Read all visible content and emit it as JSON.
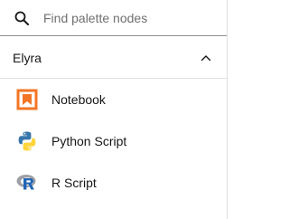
{
  "search": {
    "placeholder": "Find palette nodes",
    "value": "",
    "icon": "search-icon"
  },
  "category": {
    "title": "Elyra",
    "expanded": true,
    "icon": "chevron-up-icon"
  },
  "nodes": [
    {
      "label": "Notebook",
      "icon": "notebook-icon",
      "color": "#f37626"
    },
    {
      "label": "Python Script",
      "icon": "python-icon",
      "color": "#3776ab"
    },
    {
      "label": "R Script",
      "icon": "r-script-icon",
      "color": "#1f65b7"
    }
  ],
  "colors": {
    "notebook_orange": "#f37626",
    "python_blue": "#3776ab",
    "python_yellow": "#ffd43b",
    "r_blue": "#1f65b7",
    "r_gray": "#9ea0a5"
  }
}
